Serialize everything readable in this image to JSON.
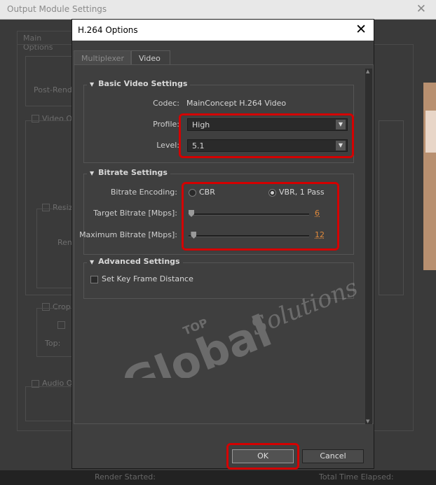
{
  "background_window": {
    "title": "Output Module Settings",
    "close_glyph": "✕",
    "tab_label": "Main Options",
    "labels": {
      "post_render": "Post-Rend",
      "video_output": "Video O",
      "resize": "Resiz",
      "rendering": "Ren",
      "crop": "Crop",
      "top": "Top:",
      "audio_output": "Audio O"
    },
    "footer": {
      "left": "Render Started:",
      "right": "Total Time Elapsed:"
    }
  },
  "dialog": {
    "title": "H.264 Options",
    "close_glyph": "✕",
    "tabs": [
      {
        "label": "Multiplexer",
        "active": false
      },
      {
        "label": "Video",
        "active": true
      }
    ],
    "basic": {
      "heading": "Basic Video Settings",
      "codec_label": "Codec:",
      "codec_value": "MainConcept H.264 Video",
      "profile_label": "Profile:",
      "profile_value": "High",
      "level_label": "Level:",
      "level_value": "5.1"
    },
    "bitrate": {
      "heading": "Bitrate Settings",
      "encoding_label": "Bitrate Encoding:",
      "cbr_label": "CBR",
      "vbr_label": "VBR, 1 Pass",
      "selected": "VBR, 1 Pass",
      "target_label": "Target Bitrate [Mbps]:",
      "target_value": "6",
      "target_fraction": 0.0,
      "max_label": "Maximum Bitrate [Mbps]:",
      "max_value": "12",
      "max_fraction": 0.02
    },
    "advanced": {
      "heading": "Advanced Settings",
      "keyframe_label": "Set Key Frame Distance",
      "keyframe_checked": false
    },
    "buttons": {
      "ok": "OK",
      "cancel": "Cancel"
    }
  },
  "watermark": {
    "line1": "TOP",
    "line2": "Global",
    "line3": "Solutions"
  },
  "colors": {
    "highlight": "#d40000",
    "slider_value": "#e08a3c",
    "dialog_bg": "#3f3f3f"
  }
}
